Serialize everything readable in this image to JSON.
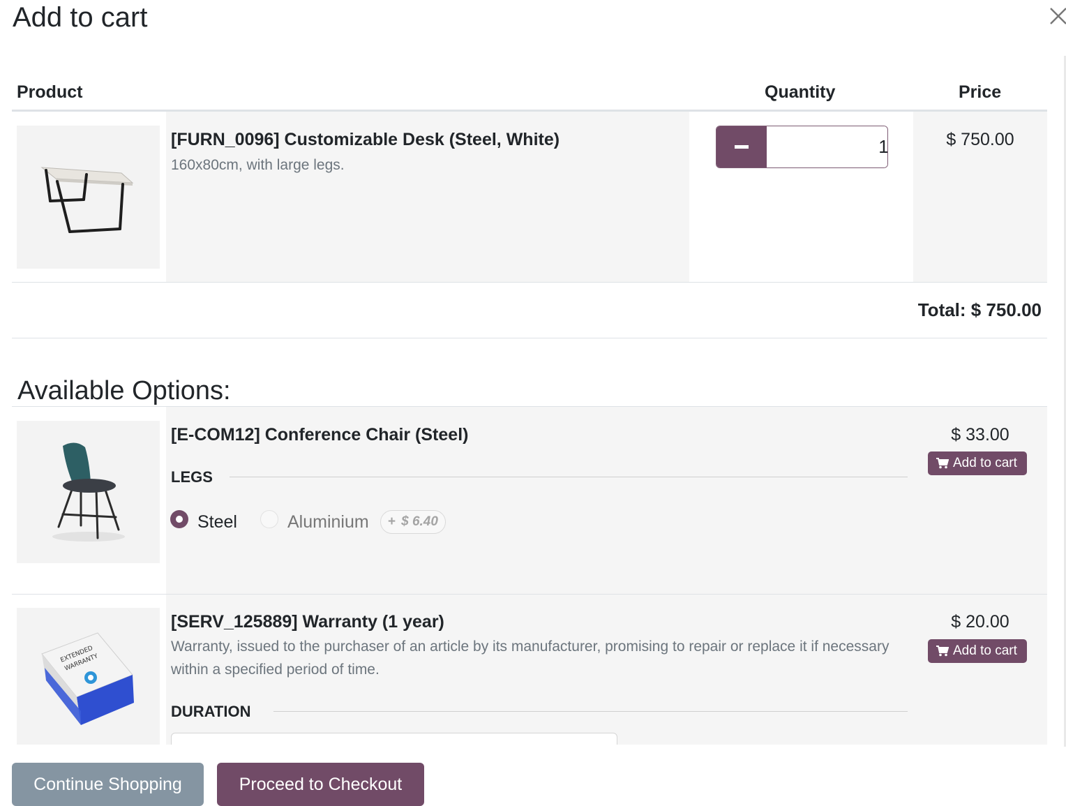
{
  "modal": {
    "title": "Add to cart"
  },
  "table": {
    "headers": {
      "product": "Product",
      "quantity": "Quantity",
      "price": "Price"
    }
  },
  "main_product": {
    "name": "[FURN_0096] Customizable Desk (Steel, White)",
    "description": "160x80cm, with large legs.",
    "quantity": "1",
    "price": "$ 750.00"
  },
  "total": {
    "label": "Total: $ 750.00"
  },
  "options": {
    "title": "Available Options:",
    "items": [
      {
        "name": "[E-COM12] Conference Chair (Steel)",
        "price": "$ 33.00",
        "add_label": "Add to cart",
        "attribute": "LEGS",
        "values": [
          {
            "label": "Steel",
            "selected": true
          },
          {
            "label": "Aluminium",
            "selected": false,
            "extra": "$ 6.40"
          }
        ]
      },
      {
        "name": "[SERV_125889] Warranty (1 year)",
        "description": "Warranty, issued to the purchaser of an article by its manufacturer, promising to repair or replace it if necessary within a specified period of time.",
        "price": "$ 20.00",
        "add_label": "Add to cart",
        "attribute": "DURATION"
      }
    ]
  },
  "footer": {
    "continue_label": "Continue Shopping",
    "checkout_label": "Proceed to Checkout"
  },
  "colors": {
    "primary": "#714b67",
    "secondary": "#8595a2",
    "row_background": "#f5f5f5",
    "muted_text": "#6c757d"
  },
  "icons": [
    "close-icon",
    "minus-icon",
    "plus-icon",
    "cart-icon",
    "desk-image",
    "chair-image",
    "warranty-box-image"
  ]
}
